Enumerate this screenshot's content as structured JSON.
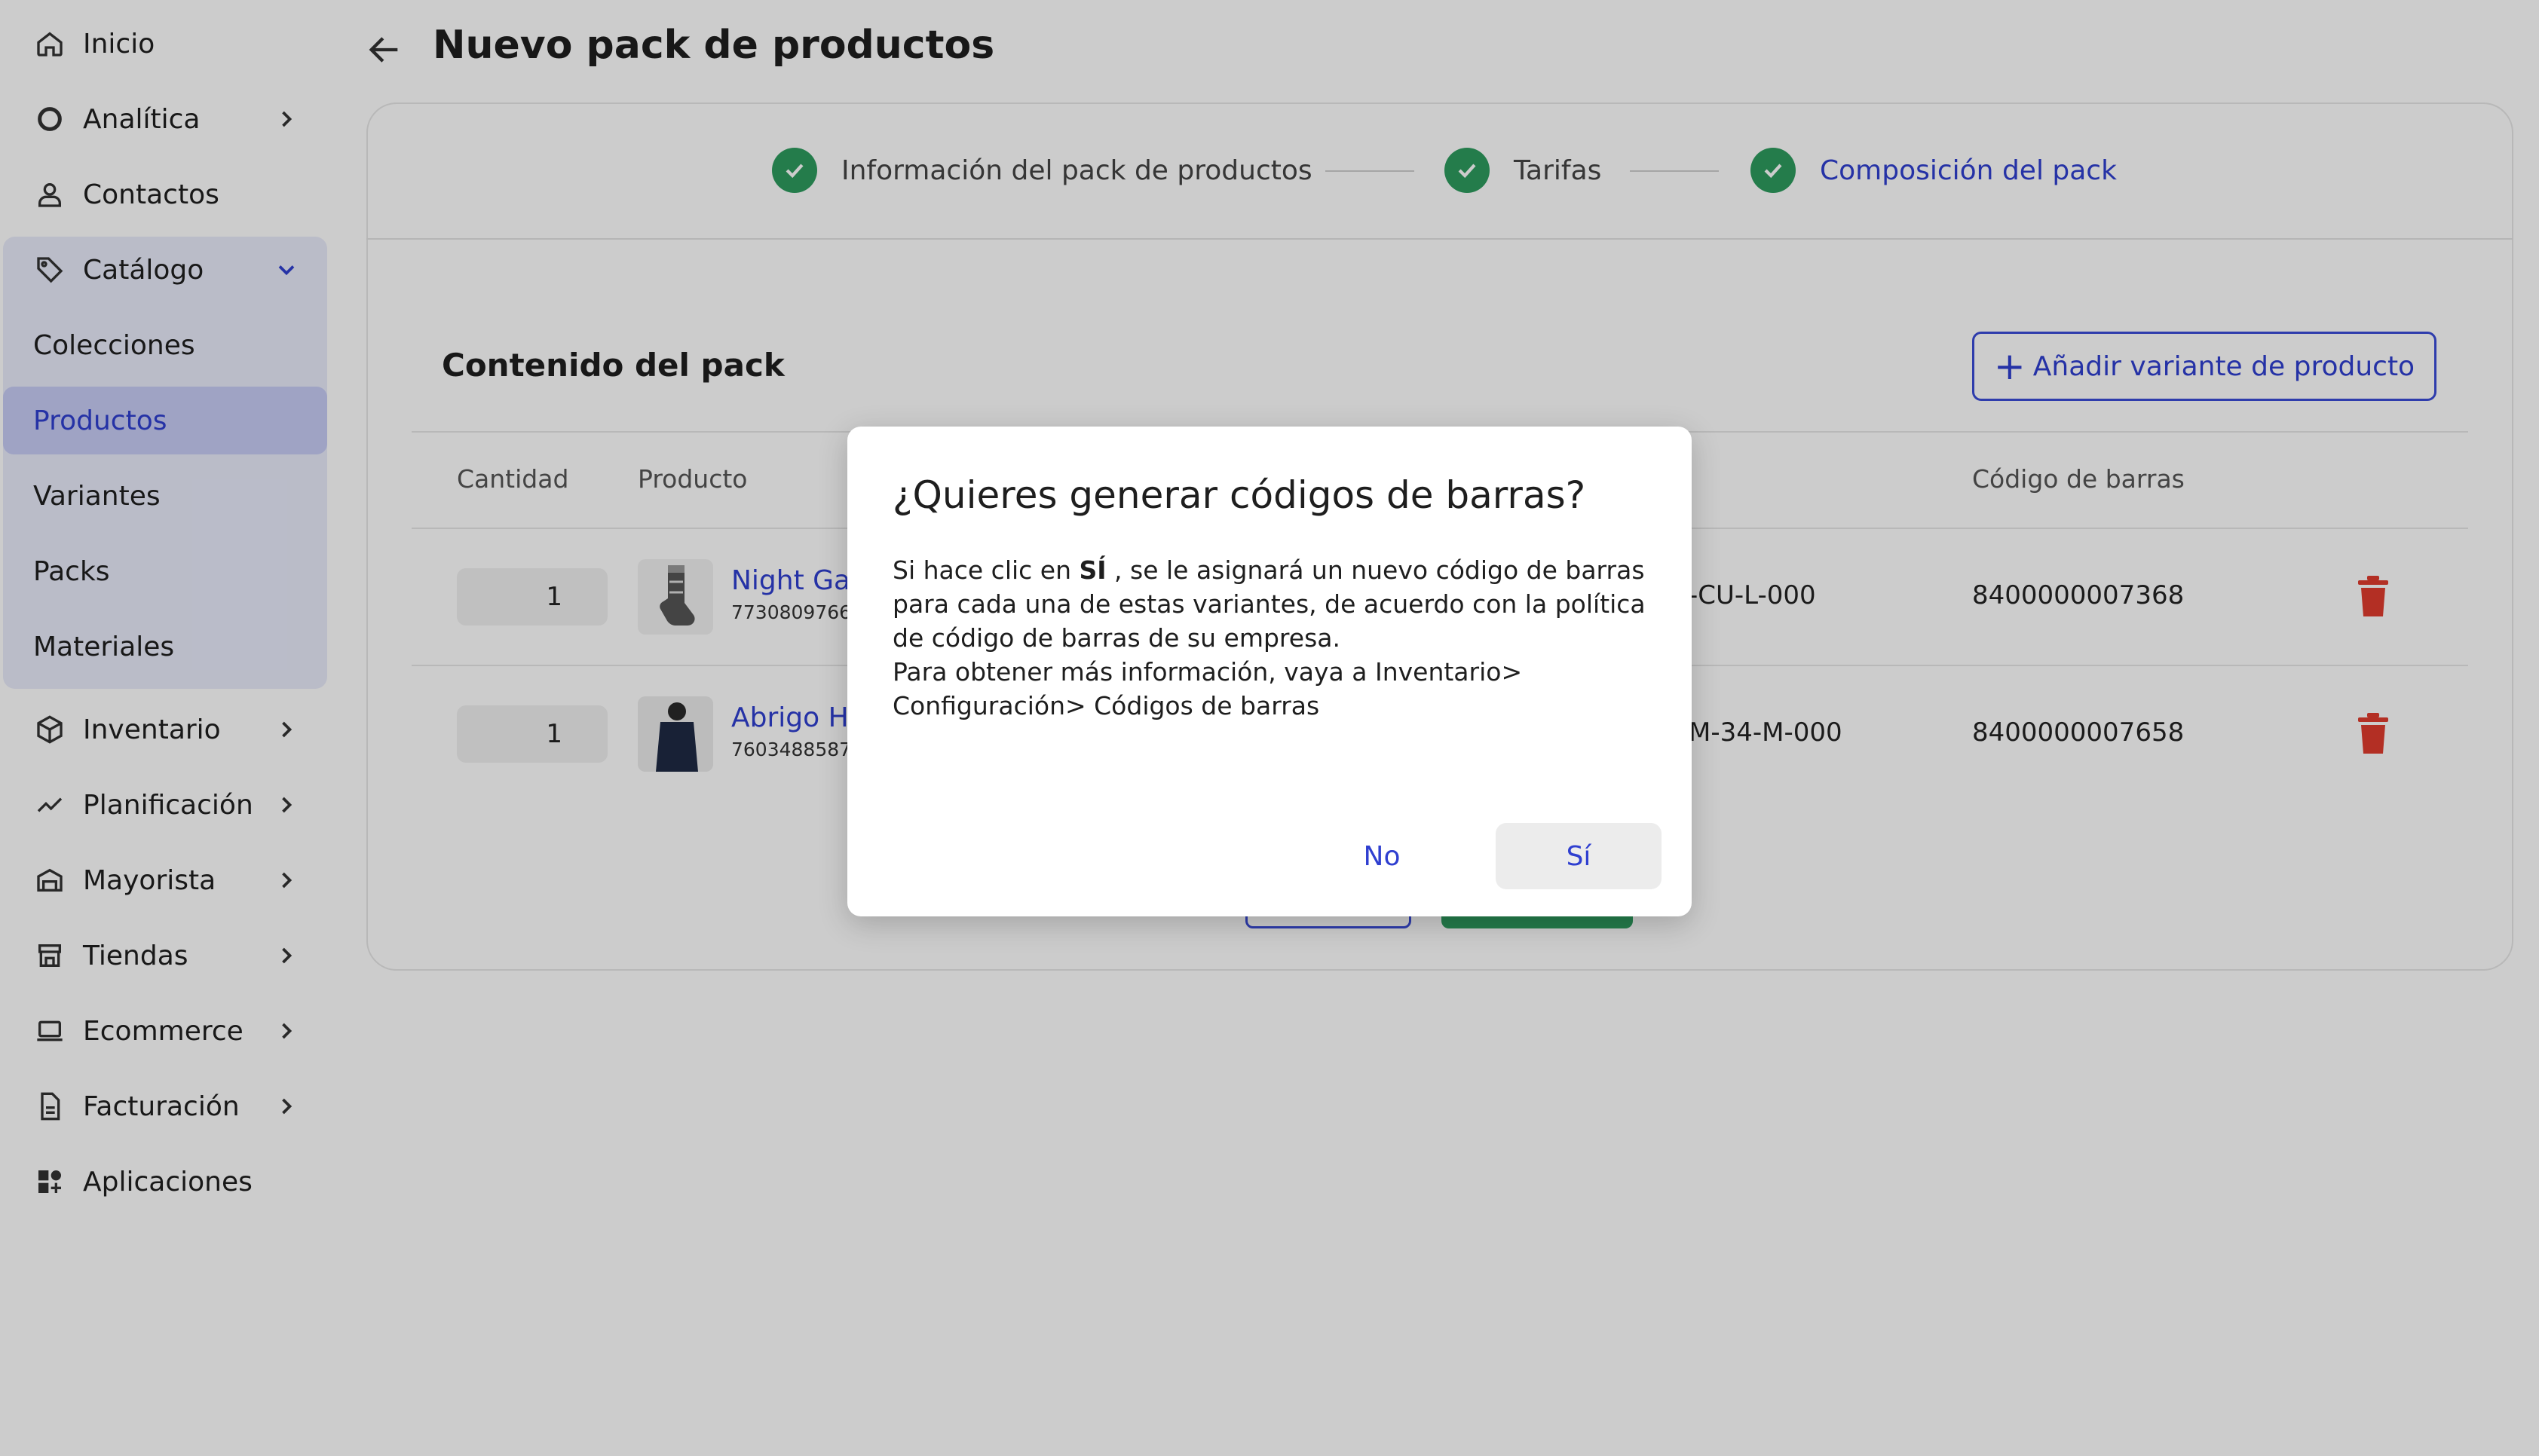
{
  "sidebar": {
    "items": [
      {
        "label": "Inicio"
      },
      {
        "label": "Analítica"
      },
      {
        "label": "Contactos"
      },
      {
        "label": "Catálogo"
      },
      {
        "label": "Inventario"
      },
      {
        "label": "Planificación"
      },
      {
        "label": "Mayorista"
      },
      {
        "label": "Tiendas"
      },
      {
        "label": "Ecommerce"
      },
      {
        "label": "Facturación"
      },
      {
        "label": "Aplicaciones"
      }
    ],
    "catalog_sub": [
      {
        "label": "Colecciones"
      },
      {
        "label": "Productos"
      },
      {
        "label": "Variantes"
      },
      {
        "label": "Packs"
      },
      {
        "label": "Materiales"
      }
    ],
    "active_sub": "Productos"
  },
  "header": {
    "title": "Nuevo pack de productos"
  },
  "stepper": {
    "steps": [
      {
        "label": "Información del pack de productos"
      },
      {
        "label": "Tarifas"
      },
      {
        "label": "Composición del pack"
      }
    ],
    "active_step": "Composición del pack"
  },
  "pack": {
    "title": "Contenido del pack",
    "add_button": "Añadir variante de producto",
    "columns": {
      "quantity": "Cantidad",
      "product": "Producto",
      "barcode": "Código de barras"
    },
    "rows": [
      {
        "qty": "1",
        "name": "Night Gat",
        "sku": "7730809766",
        "variant": "-CU-L-000",
        "barcode": "8400000007368"
      },
      {
        "qty": "1",
        "name": "Abrigo Ho",
        "sku": "7603488587",
        "variant": "M-34-M-000",
        "barcode": "8400000007658"
      }
    ]
  },
  "dialog": {
    "title": "¿Quieres generar códigos de barras?",
    "body_pre": "Si hace clic en ",
    "body_bold": "SÍ",
    "body_post": " , se le asignará un nuevo código de barras para cada una de estas variantes, de acuerdo con la política de código de barras de su empresa.",
    "body_line2": "Para obtener más información, vaya a Inventario> Configuración> Códigos de barras",
    "no_label": "No",
    "yes_label": "Sí"
  },
  "colors": {
    "accent": "#2f3fd0",
    "success": "#2e9c5e",
    "danger": "#e03b2e",
    "catalog_bg": "#e9ebfb",
    "active_bg": "#c7ccf5"
  }
}
